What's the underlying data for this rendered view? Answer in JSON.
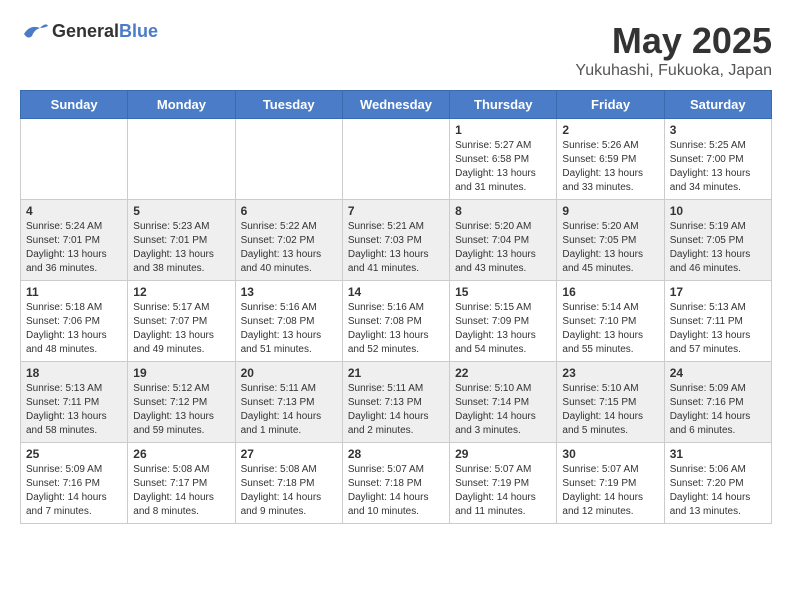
{
  "header": {
    "logo": {
      "general": "General",
      "blue": "Blue"
    },
    "title": "May 2025",
    "location": "Yukuhashi, Fukuoka, Japan"
  },
  "days_of_week": [
    "Sunday",
    "Monday",
    "Tuesday",
    "Wednesday",
    "Thursday",
    "Friday",
    "Saturday"
  ],
  "weeks": [
    [
      {
        "day": "",
        "info": ""
      },
      {
        "day": "",
        "info": ""
      },
      {
        "day": "",
        "info": ""
      },
      {
        "day": "",
        "info": ""
      },
      {
        "day": "1",
        "info": "Sunrise: 5:27 AM\nSunset: 6:58 PM\nDaylight: 13 hours\nand 31 minutes."
      },
      {
        "day": "2",
        "info": "Sunrise: 5:26 AM\nSunset: 6:59 PM\nDaylight: 13 hours\nand 33 minutes."
      },
      {
        "day": "3",
        "info": "Sunrise: 5:25 AM\nSunset: 7:00 PM\nDaylight: 13 hours\nand 34 minutes."
      }
    ],
    [
      {
        "day": "4",
        "info": "Sunrise: 5:24 AM\nSunset: 7:01 PM\nDaylight: 13 hours\nand 36 minutes."
      },
      {
        "day": "5",
        "info": "Sunrise: 5:23 AM\nSunset: 7:01 PM\nDaylight: 13 hours\nand 38 minutes."
      },
      {
        "day": "6",
        "info": "Sunrise: 5:22 AM\nSunset: 7:02 PM\nDaylight: 13 hours\nand 40 minutes."
      },
      {
        "day": "7",
        "info": "Sunrise: 5:21 AM\nSunset: 7:03 PM\nDaylight: 13 hours\nand 41 minutes."
      },
      {
        "day": "8",
        "info": "Sunrise: 5:20 AM\nSunset: 7:04 PM\nDaylight: 13 hours\nand 43 minutes."
      },
      {
        "day": "9",
        "info": "Sunrise: 5:20 AM\nSunset: 7:05 PM\nDaylight: 13 hours\nand 45 minutes."
      },
      {
        "day": "10",
        "info": "Sunrise: 5:19 AM\nSunset: 7:05 PM\nDaylight: 13 hours\nand 46 minutes."
      }
    ],
    [
      {
        "day": "11",
        "info": "Sunrise: 5:18 AM\nSunset: 7:06 PM\nDaylight: 13 hours\nand 48 minutes."
      },
      {
        "day": "12",
        "info": "Sunrise: 5:17 AM\nSunset: 7:07 PM\nDaylight: 13 hours\nand 49 minutes."
      },
      {
        "day": "13",
        "info": "Sunrise: 5:16 AM\nSunset: 7:08 PM\nDaylight: 13 hours\nand 51 minutes."
      },
      {
        "day": "14",
        "info": "Sunrise: 5:16 AM\nSunset: 7:08 PM\nDaylight: 13 hours\nand 52 minutes."
      },
      {
        "day": "15",
        "info": "Sunrise: 5:15 AM\nSunset: 7:09 PM\nDaylight: 13 hours\nand 54 minutes."
      },
      {
        "day": "16",
        "info": "Sunrise: 5:14 AM\nSunset: 7:10 PM\nDaylight: 13 hours\nand 55 minutes."
      },
      {
        "day": "17",
        "info": "Sunrise: 5:13 AM\nSunset: 7:11 PM\nDaylight: 13 hours\nand 57 minutes."
      }
    ],
    [
      {
        "day": "18",
        "info": "Sunrise: 5:13 AM\nSunset: 7:11 PM\nDaylight: 13 hours\nand 58 minutes."
      },
      {
        "day": "19",
        "info": "Sunrise: 5:12 AM\nSunset: 7:12 PM\nDaylight: 13 hours\nand 59 minutes."
      },
      {
        "day": "20",
        "info": "Sunrise: 5:11 AM\nSunset: 7:13 PM\nDaylight: 14 hours\nand 1 minute."
      },
      {
        "day": "21",
        "info": "Sunrise: 5:11 AM\nSunset: 7:13 PM\nDaylight: 14 hours\nand 2 minutes."
      },
      {
        "day": "22",
        "info": "Sunrise: 5:10 AM\nSunset: 7:14 PM\nDaylight: 14 hours\nand 3 minutes."
      },
      {
        "day": "23",
        "info": "Sunrise: 5:10 AM\nSunset: 7:15 PM\nDaylight: 14 hours\nand 5 minutes."
      },
      {
        "day": "24",
        "info": "Sunrise: 5:09 AM\nSunset: 7:16 PM\nDaylight: 14 hours\nand 6 minutes."
      }
    ],
    [
      {
        "day": "25",
        "info": "Sunrise: 5:09 AM\nSunset: 7:16 PM\nDaylight: 14 hours\nand 7 minutes."
      },
      {
        "day": "26",
        "info": "Sunrise: 5:08 AM\nSunset: 7:17 PM\nDaylight: 14 hours\nand 8 minutes."
      },
      {
        "day": "27",
        "info": "Sunrise: 5:08 AM\nSunset: 7:18 PM\nDaylight: 14 hours\nand 9 minutes."
      },
      {
        "day": "28",
        "info": "Sunrise: 5:07 AM\nSunset: 7:18 PM\nDaylight: 14 hours\nand 10 minutes."
      },
      {
        "day": "29",
        "info": "Sunrise: 5:07 AM\nSunset: 7:19 PM\nDaylight: 14 hours\nand 11 minutes."
      },
      {
        "day": "30",
        "info": "Sunrise: 5:07 AM\nSunset: 7:19 PM\nDaylight: 14 hours\nand 12 minutes."
      },
      {
        "day": "31",
        "info": "Sunrise: 5:06 AM\nSunset: 7:20 PM\nDaylight: 14 hours\nand 13 minutes."
      }
    ]
  ]
}
